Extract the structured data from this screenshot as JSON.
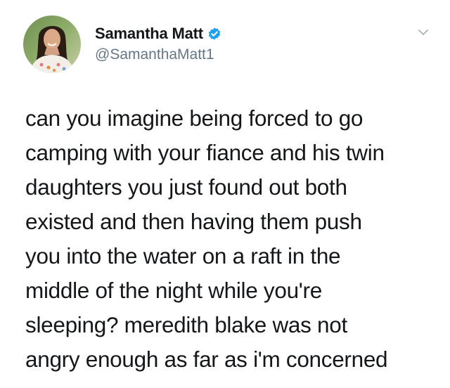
{
  "tweet": {
    "author": {
      "name": "Samantha Matt",
      "handle": "@SamanthaMatt1",
      "verified": true,
      "verified_color": "#1da1f2",
      "avatar_icon": "profile-photo"
    },
    "menu_icon": "chevron-down-icon",
    "text_lines": [
      "can you imagine being forced to go",
      "camping with your fiance and his twin",
      "daughters you just found out both",
      "existed and then having them push",
      "you into the water on a raft in the",
      "middle of the night while you're",
      "sleeping? meredith blake was not",
      "angry enough as far as i'm concerned"
    ]
  }
}
